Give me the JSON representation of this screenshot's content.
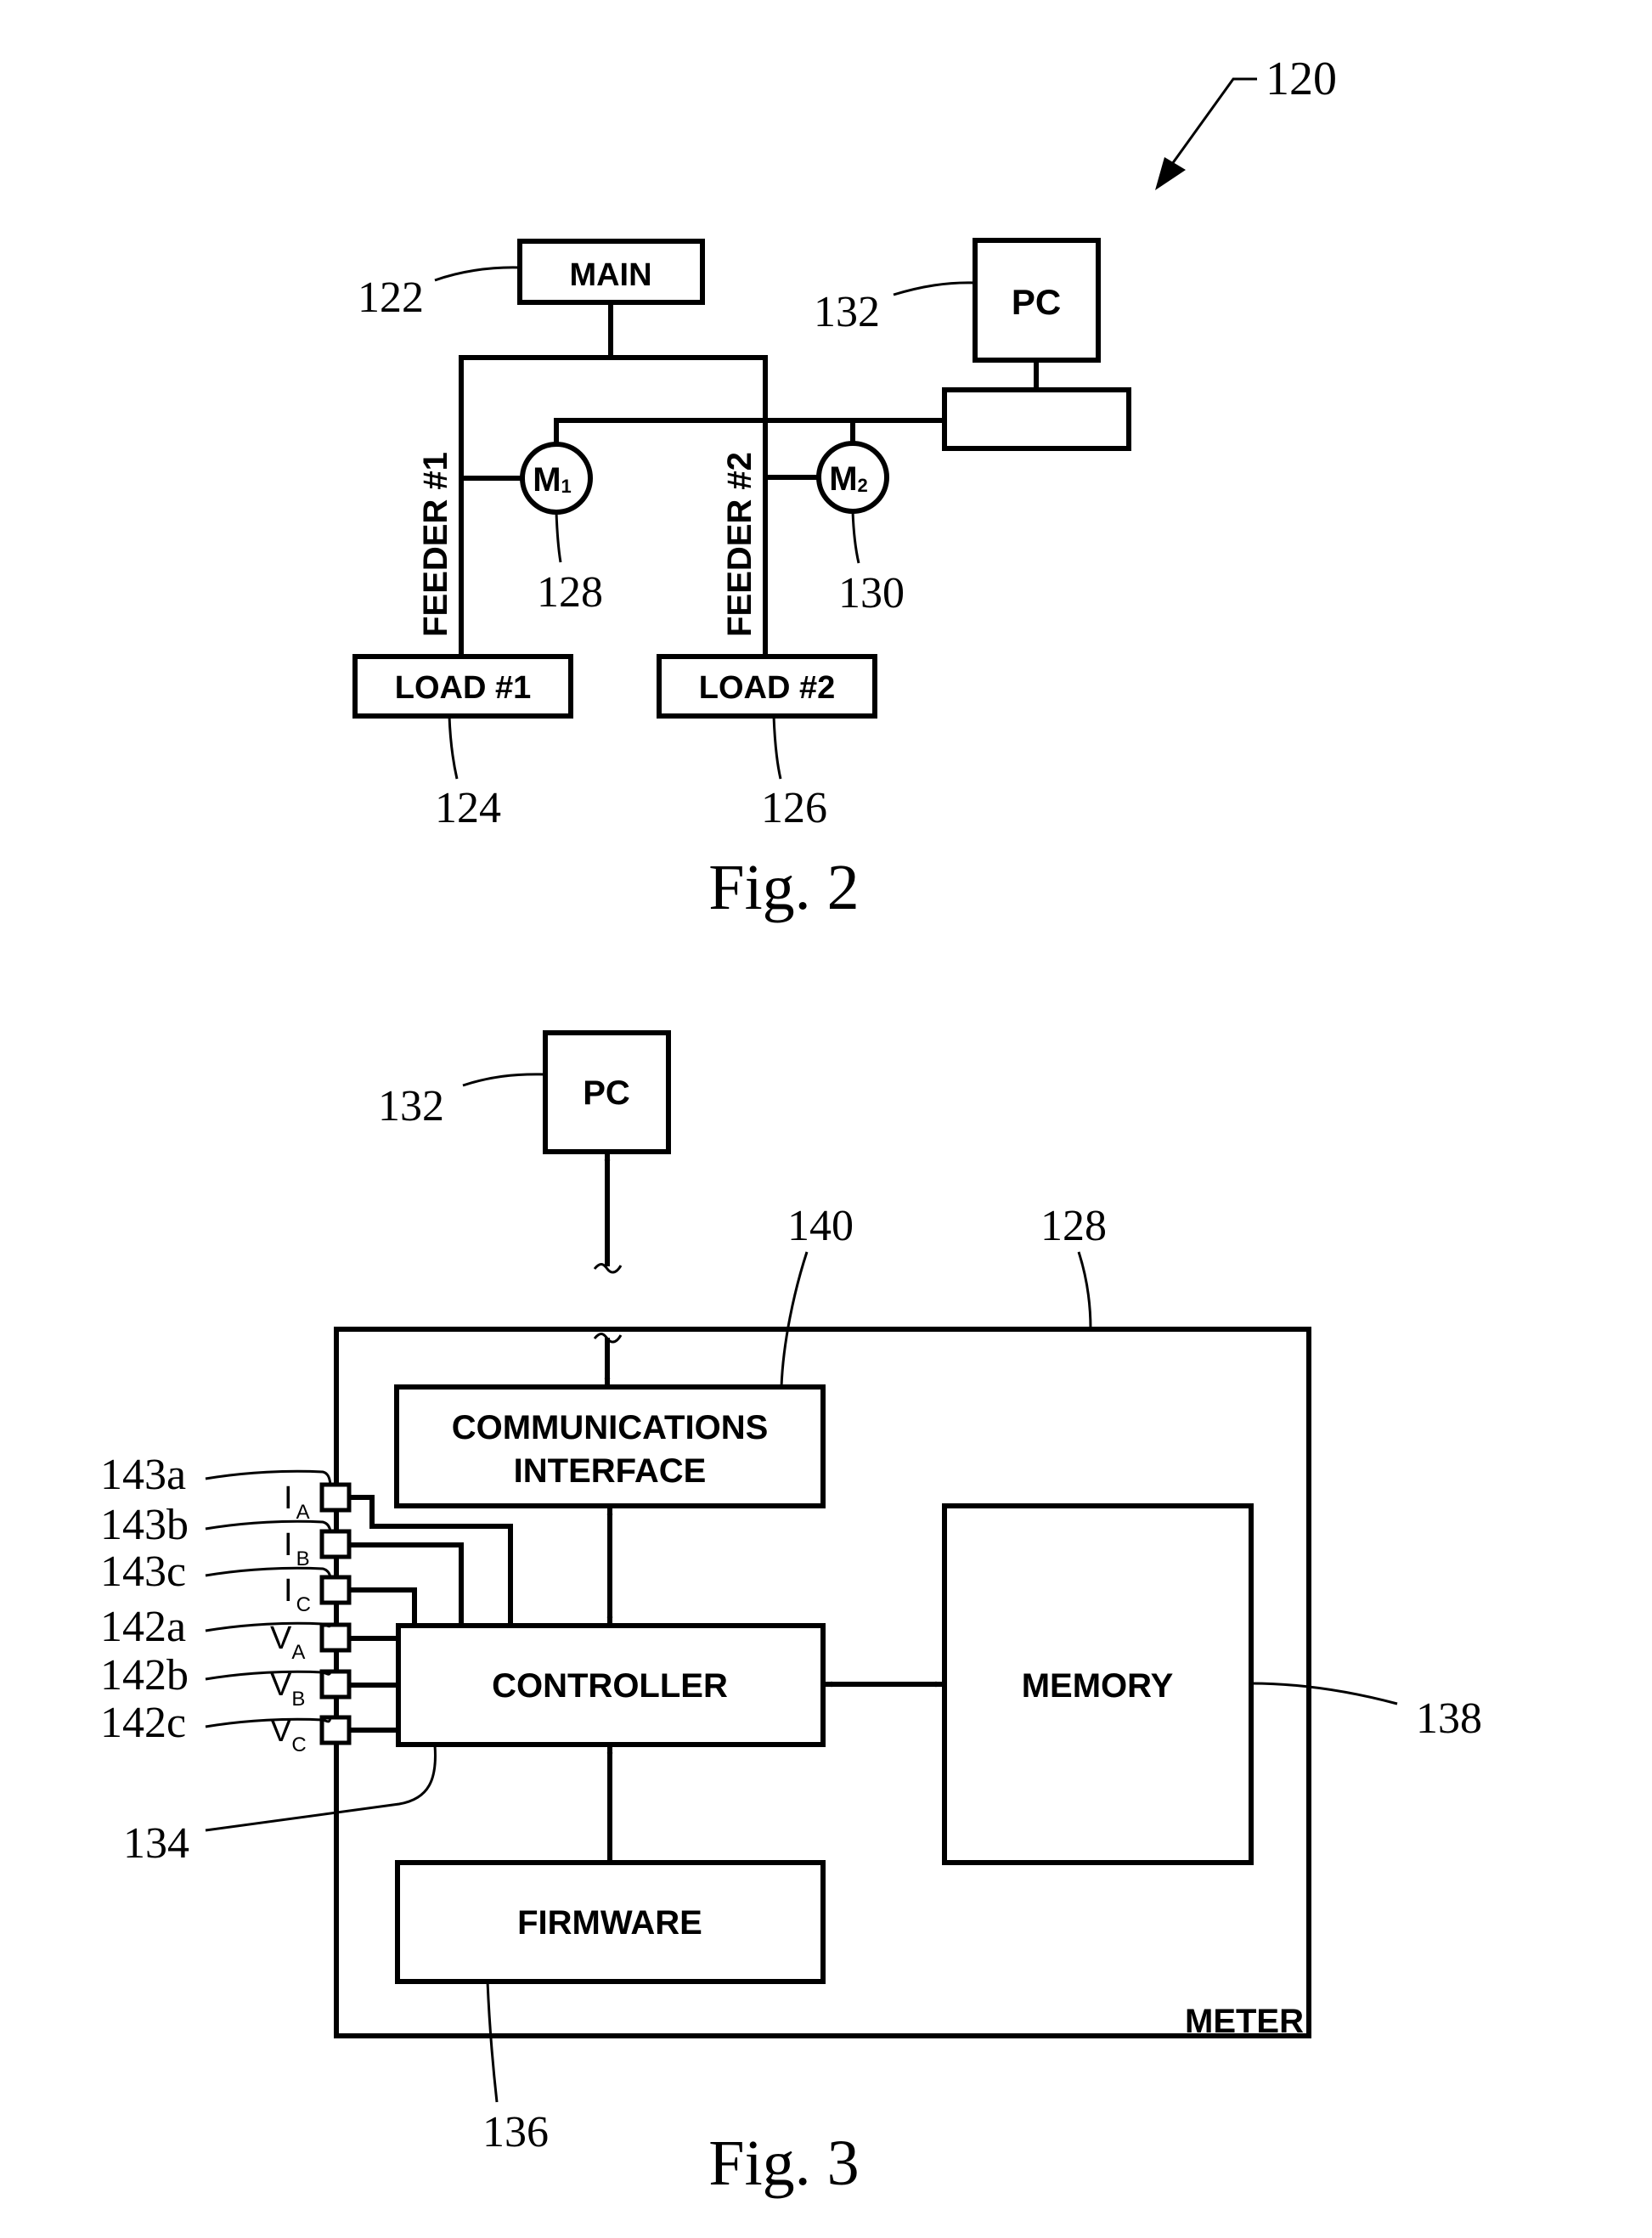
{
  "figures": [
    {
      "caption": "Fig. 2",
      "system_ref": "120",
      "blocks": {
        "main": {
          "label": "MAIN",
          "ref": "122"
        },
        "load1": {
          "label": "LOAD #1",
          "ref": "124"
        },
        "load2": {
          "label": "LOAD #2",
          "ref": "126"
        },
        "pc": {
          "label": "PC",
          "ref": "132"
        },
        "interface": {
          "label": ""
        }
      },
      "feeders": [
        {
          "label": "FEEDER #1"
        },
        {
          "label": "FEEDER #2"
        }
      ],
      "meters": [
        {
          "label": "M",
          "sub": "1",
          "ref": "128"
        },
        {
          "label": "M",
          "sub": "2",
          "ref": "130"
        }
      ]
    },
    {
      "caption": "Fig. 3",
      "blocks": {
        "pc": {
          "label": "PC",
          "ref": "132"
        },
        "comm": {
          "line1": "COMMUNICATIONS",
          "line2": "INTERFACE",
          "ref": "140"
        },
        "controller": {
          "label": "CONTROLLER",
          "ref": "134"
        },
        "memory": {
          "label": "MEMORY",
          "ref": "138"
        },
        "firmware": {
          "label": "FIRMWARE",
          "ref": "136"
        },
        "meter": {
          "label": "METER",
          "ref": "128"
        }
      },
      "inputs": [
        {
          "ref": "143a",
          "sym": "I",
          "sub": "A"
        },
        {
          "ref": "143b",
          "sym": "I",
          "sub": "B"
        },
        {
          "ref": "143c",
          "sym": "I",
          "sub": "C"
        },
        {
          "ref": "142a",
          "sym": "V",
          "sub": "A"
        },
        {
          "ref": "142b",
          "sym": "V",
          "sub": "B"
        },
        {
          "ref": "142c",
          "sym": "V",
          "sub": "C"
        }
      ]
    }
  ]
}
